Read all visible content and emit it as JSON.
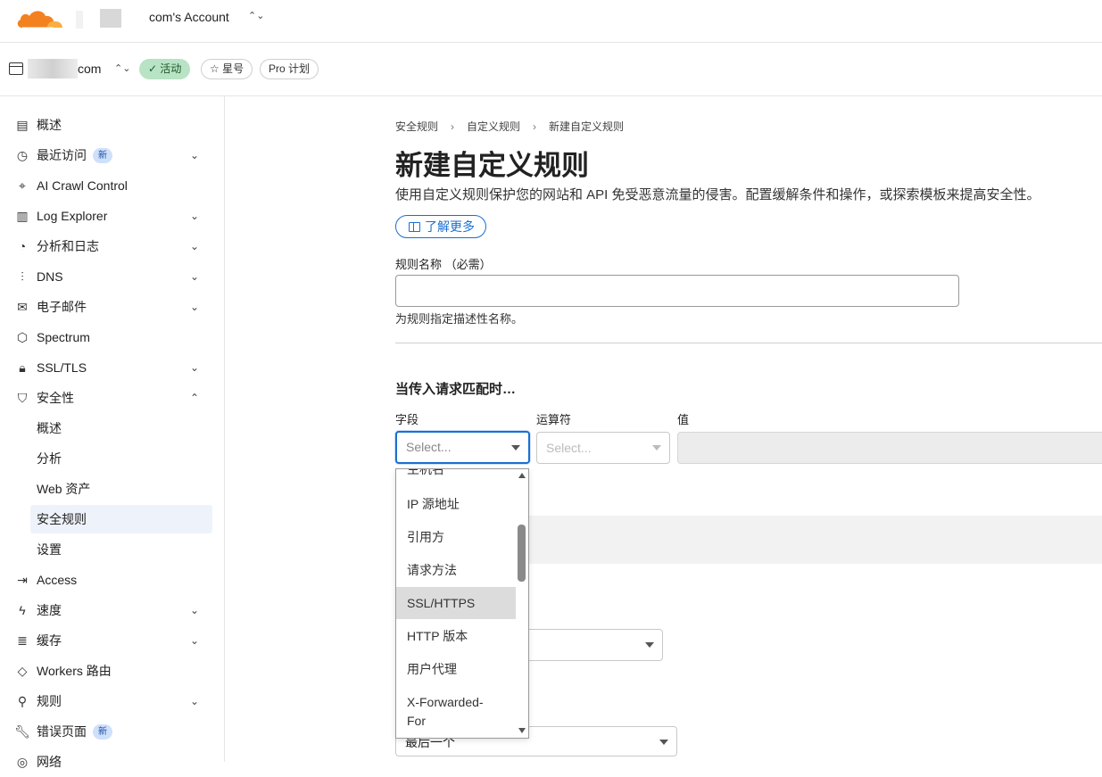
{
  "topbar": {
    "account_name": "com's Account",
    "account_caret": "⌃⌄"
  },
  "zone": {
    "name": "com",
    "caret": "⌃⌄",
    "status": "✓ 活动",
    "star": "☆ 星号",
    "plan": "Pro 计划"
  },
  "sidebar": {
    "items": [
      {
        "label": "概述",
        "icon": "document-icon",
        "glyph": "▤"
      },
      {
        "label": "最近访问",
        "icon": "history-icon",
        "glyph": "◷",
        "badge": "新",
        "chevron": "⌄"
      },
      {
        "label": "AI Crawl Control",
        "icon": "robot-icon",
        "glyph": "⌖"
      },
      {
        "label": "Log Explorer",
        "icon": "log-icon",
        "glyph": "▥",
        "chevron": "⌄"
      },
      {
        "label": "分析和日志",
        "icon": "chart-pie-icon",
        "glyph": "◔",
        "chevron": "⌄"
      },
      {
        "label": "DNS",
        "icon": "network-icon",
        "glyph": "⫶",
        "chevron": "⌄"
      },
      {
        "label": "电子邮件",
        "icon": "mail-icon",
        "glyph": "✉",
        "chevron": "⌄"
      },
      {
        "label": "Spectrum",
        "icon": "shield-star-icon",
        "glyph": "⬡"
      },
      {
        "label": "SSL/TLS",
        "icon": "lock-icon",
        "glyph": "🔒︎",
        "chevron": "⌄"
      },
      {
        "label": "安全性",
        "icon": "shield-icon",
        "glyph": "⛉",
        "chevron": "⌃"
      }
    ],
    "security_sub": [
      "概述",
      "分析",
      "Web 资产",
      "安全规则",
      "设置"
    ],
    "items_after": [
      {
        "label": "Access",
        "icon": "access-icon",
        "glyph": "⇥"
      },
      {
        "label": "速度",
        "icon": "bolt-icon",
        "glyph": "ϟ",
        "chevron": "⌄"
      },
      {
        "label": "缓存",
        "icon": "cache-icon",
        "glyph": "≣",
        "chevron": "⌄"
      },
      {
        "label": "Workers 路由",
        "icon": "workers-icon",
        "glyph": "◇"
      },
      {
        "label": "规则",
        "icon": "rules-icon",
        "glyph": "⚲",
        "chevron": "⌄"
      },
      {
        "label": "错误页面",
        "icon": "wrench-icon",
        "glyph": "🔧︎",
        "badge": "新"
      },
      {
        "label": "网络",
        "icon": "network-globe-icon",
        "glyph": "◎"
      }
    ]
  },
  "main": {
    "breadcrumb": [
      "安全规则",
      "自定义规则",
      "新建自定义规则"
    ],
    "breadcrumb_sep": "›",
    "title": "新建自定义规则",
    "description": "使用自定义规则保护您的网站和 API 免受恶意流量的侵害。配置缓解条件和操作，或探索模板来提高安全性。",
    "learn_more": "了解更多",
    "rule_name_label": "规则名称 （必需）",
    "rule_name_value": "",
    "rule_name_help": "为规则指定描述性名称。",
    "match_title": "当传入请求匹配时…",
    "field_label": "字段",
    "operator_label": "运算符",
    "value_label": "值",
    "field_placeholder": "Select...",
    "operator_placeholder": "Select...",
    "last_select_value": "最后一个"
  },
  "dropdown": {
    "options": [
      "主机名",
      "IP 源地址",
      "引用方",
      "请求方法",
      "SSL/HTTPS",
      "HTTP 版本",
      "用户代理",
      "X-Forwarded-",
      "For"
    ],
    "selected": "SSL/HTTPS"
  },
  "colors": {
    "accent": "#1a6fd1",
    "active_green": "#b8e3c4",
    "badge_blue": "#cfe0fb",
    "brand_orange": "#f48120"
  }
}
